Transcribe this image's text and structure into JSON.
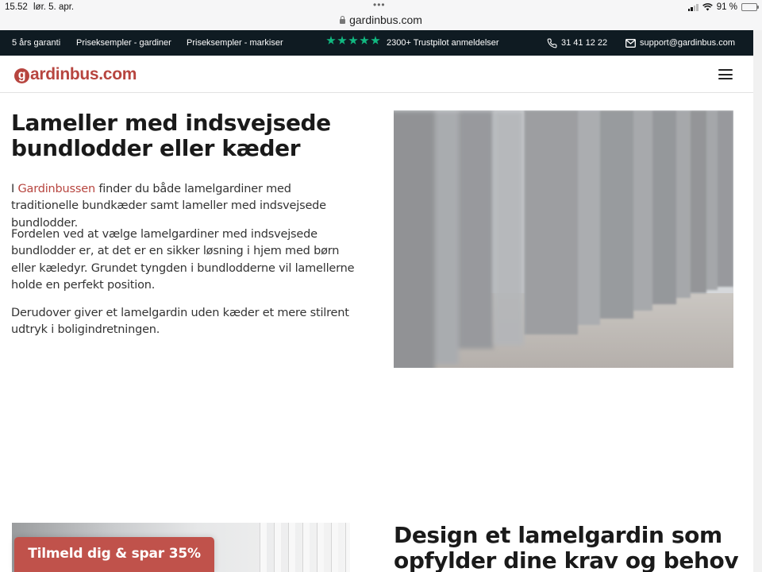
{
  "status_bar": {
    "time": "15.52",
    "date": "lør. 5. apr.",
    "battery": "91 %"
  },
  "browser": {
    "url": "gardinbus.com"
  },
  "topbar": {
    "guarantee": "5 års garanti",
    "link_curtains": "Priseksempler - gardiner",
    "link_awnings": "Priseksempler - markiser",
    "trustpilot": "2300+ Trustpilot anmeldelser",
    "rating_stars": 5,
    "phone": "31 41 12 22",
    "email": "support@gardinbus.com",
    "star_color": "#11b981"
  },
  "header": {
    "logo": "ardinbus.com",
    "logo_initial": "g",
    "brand_color": "#b7453f"
  },
  "main": {
    "title": "Lameller med indsvejsede bundlodder eller kæder",
    "para1_prefix": "I ",
    "para1_link": "Gardinbussen",
    "para1_rest": " finder du både lamelgardiner med traditionelle bundkæder samt lameller med indsvejsede bundlodder.",
    "para2": "Fordelen ved at vælge lamelgardiner med indsvejsede bundlodder er, at det er en sikker løsning i hjem med børn eller kæledyr. Grundet tyngden i bundlodderne vil lamellerne holde en perfekt position.",
    "para3": "Derudover giver et lamelgardin uden kæder et mere stilrent udtryk i boligindretningen.",
    "section2_title": "Design et lamelgardin som opfylder dine krav og behov"
  },
  "cta": {
    "label": "Tilmeld dig & spar 35%",
    "color": "#c0524b"
  }
}
